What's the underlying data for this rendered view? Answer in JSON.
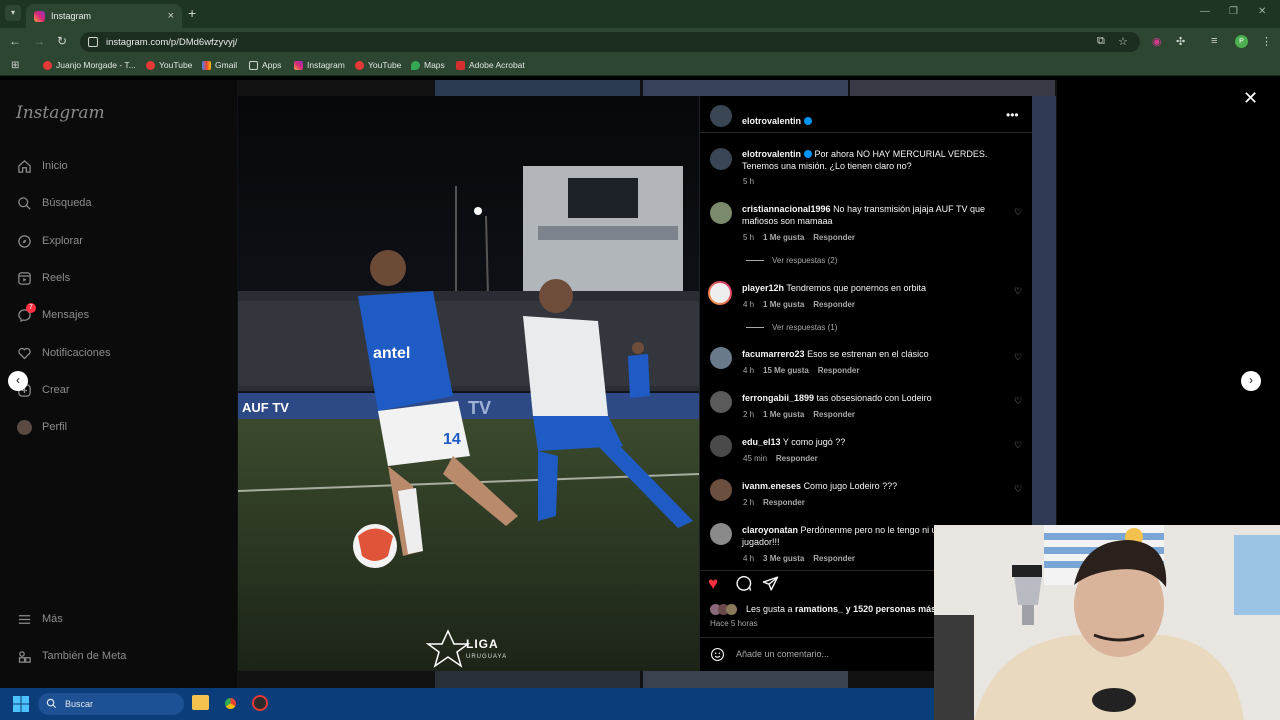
{
  "browser": {
    "tab_title": "Instagram",
    "new_tab": "+",
    "url": "instagram.com/p/DMd6wfzyvyj/",
    "profile_initial": "P",
    "bookmarks": [
      {
        "label": "Juanjo Morgade - T...",
        "icon": "youtube-icon"
      },
      {
        "label": "YouTube",
        "icon": "youtube-icon"
      },
      {
        "label": "Gmail",
        "icon": "gmail-icon"
      },
      {
        "label": "Apps",
        "icon": "folder-icon"
      },
      {
        "label": "Instagram",
        "icon": "instagram-icon"
      },
      {
        "label": "YouTube",
        "icon": "youtube-icon"
      },
      {
        "label": "Maps",
        "icon": "maps-icon"
      },
      {
        "label": "Adobe Acrobat",
        "icon": "acrobat-icon"
      }
    ]
  },
  "sidebar": {
    "logo": "Instagram",
    "items": [
      {
        "label": "Inicio",
        "icon": "home-icon"
      },
      {
        "label": "Búsqueda",
        "icon": "search-icon"
      },
      {
        "label": "Explorar",
        "icon": "compass-icon"
      },
      {
        "label": "Reels",
        "icon": "reels-icon"
      },
      {
        "label": "Mensajes",
        "icon": "messenger-icon",
        "badge": "7"
      },
      {
        "label": "Notificaciones",
        "icon": "heart-icon"
      },
      {
        "label": "Crear",
        "icon": "plus-icon"
      },
      {
        "label": "Perfil",
        "icon": "avatar"
      }
    ],
    "more": "Más",
    "meta": "También de Meta"
  },
  "photo": {
    "league_label": "LIGA",
    "league_sub": "URUGUAYA",
    "jersey_number": "14",
    "sponsor": "antel",
    "board_left": "AUF TV",
    "board_right": "TV"
  },
  "post": {
    "author": "elotrovalentin",
    "caption": "Por ahora NO HAY MERCURIAL VERDES. Tenemos una misión. ¿Lo tienen claro no?",
    "caption_time": "5 h",
    "comments": [
      {
        "user": "cristiannacional1996",
        "text": "No hay transmisión jajaja AUF TV que mafiosos son mamaaa",
        "time": "5 h",
        "likes": "1 Me gusta",
        "reply": "Responder",
        "view_replies": "Ver respuestas (2)"
      },
      {
        "user": "player12h",
        "text": "Tendremos que ponernos en orbita",
        "time": "4 h",
        "likes": "1 Me gusta",
        "reply": "Responder",
        "view_replies": "Ver respuestas (1)"
      },
      {
        "user": "facumarrero23",
        "text": "Esos se estrenan en el clásico",
        "time": "4 h",
        "likes": "15 Me gusta",
        "reply": "Responder"
      },
      {
        "user": "ferrongabii_1899",
        "text": "tas obsesionado con Lodeiro",
        "time": "2 h",
        "likes": "1 Me gusta",
        "reply": "Responder"
      },
      {
        "user": "edu_el13",
        "text": "Y como jugó ??",
        "time": "45 min",
        "reply": "Responder"
      },
      {
        "user": "ivanm.eneses",
        "text": "Como jugo Lodeiro ???",
        "time": "2 h",
        "reply": "Responder"
      },
      {
        "user": "claroyonatan",
        "text": "Perdónenme pero no le tengo ni un ex jugador!!!",
        "time": "4 h",
        "likes": "3 Me gusta",
        "reply": "Responder"
      }
    ],
    "likes_prefix": "Les gusta a ",
    "likes_user": "ramations_",
    "likes_suffix": " y 1520 personas más",
    "posted": "Hace 5 horas",
    "add_comment_placeholder": "Añade un comentario..."
  },
  "taskbar": {
    "search_label": "Buscar"
  },
  "colors": {
    "chrome_tabbar": "#1f3524",
    "chrome_toolbar": "#2d4632",
    "like_red": "#ff3040",
    "verified_blue": "#0095f6",
    "taskbar": "#0b3d7a"
  }
}
